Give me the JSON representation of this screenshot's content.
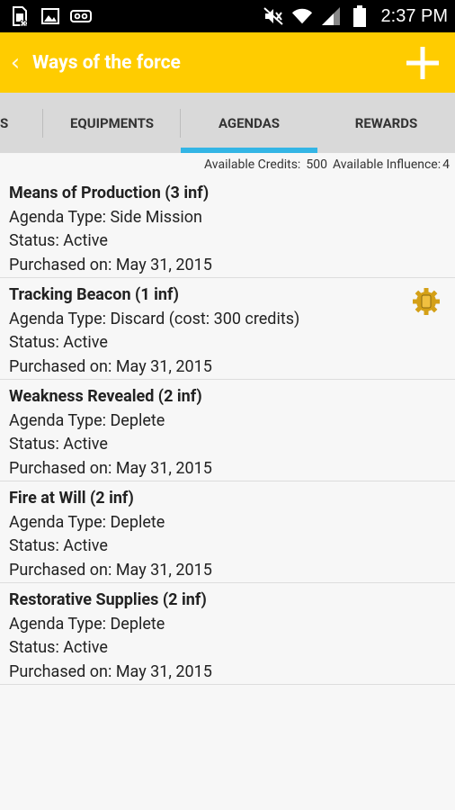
{
  "status_bar": {
    "time": "2:37 PM",
    "icons": [
      "sim-card-icon",
      "image-icon",
      "voicemail-icon",
      "mute-icon",
      "wifi-icon",
      "signal-icon",
      "battery-icon"
    ]
  },
  "app_bar": {
    "title": "Ways of the force",
    "back_icon": "chevron-left-icon",
    "add_icon": "plus-icon"
  },
  "tabs": [
    {
      "label": "S",
      "active": false
    },
    {
      "label": "EQUIPMENTS",
      "active": false
    },
    {
      "label": "AGENDAS",
      "active": true
    },
    {
      "label": "REWARDS",
      "active": false
    }
  ],
  "credits": {
    "credits_label": "Available Credits:",
    "credits_value": "500",
    "influence_label": "Available Influence:",
    "influence_value": "4"
  },
  "agendas": [
    {
      "title": "Means of Production (3 inf)",
      "type": "Agenda Type: Side Mission",
      "status": "Status: Active",
      "purchased": "Purchased on: May 31, 2015"
    },
    {
      "title": "Tracking Beacon (1 inf)",
      "type": "Agenda Type: Discard (cost: 300 credits)",
      "status": "Status: Active",
      "purchased": "Purchased on: May 31, 2015",
      "icon": "gear-icon"
    },
    {
      "title": "Weakness Revealed (2 inf)",
      "type": "Agenda Type: Deplete",
      "status": "Status: Active",
      "purchased": "Purchased on: May 31, 2015"
    },
    {
      "title": "Fire at Will (2 inf)",
      "type": "Agenda Type: Deplete",
      "status": "Status: Active",
      "purchased": "Purchased on: May 31, 2015"
    },
    {
      "title": "Restorative Supplies (2 inf)",
      "type": "Agenda Type: Deplete",
      "status": "Status: Active",
      "purchased": "Purchased on: May 31, 2015"
    }
  ],
  "colors": {
    "accent": "#ffcc00",
    "tab_indicator": "#33b5e5",
    "gear_icon": "#d4a017"
  }
}
